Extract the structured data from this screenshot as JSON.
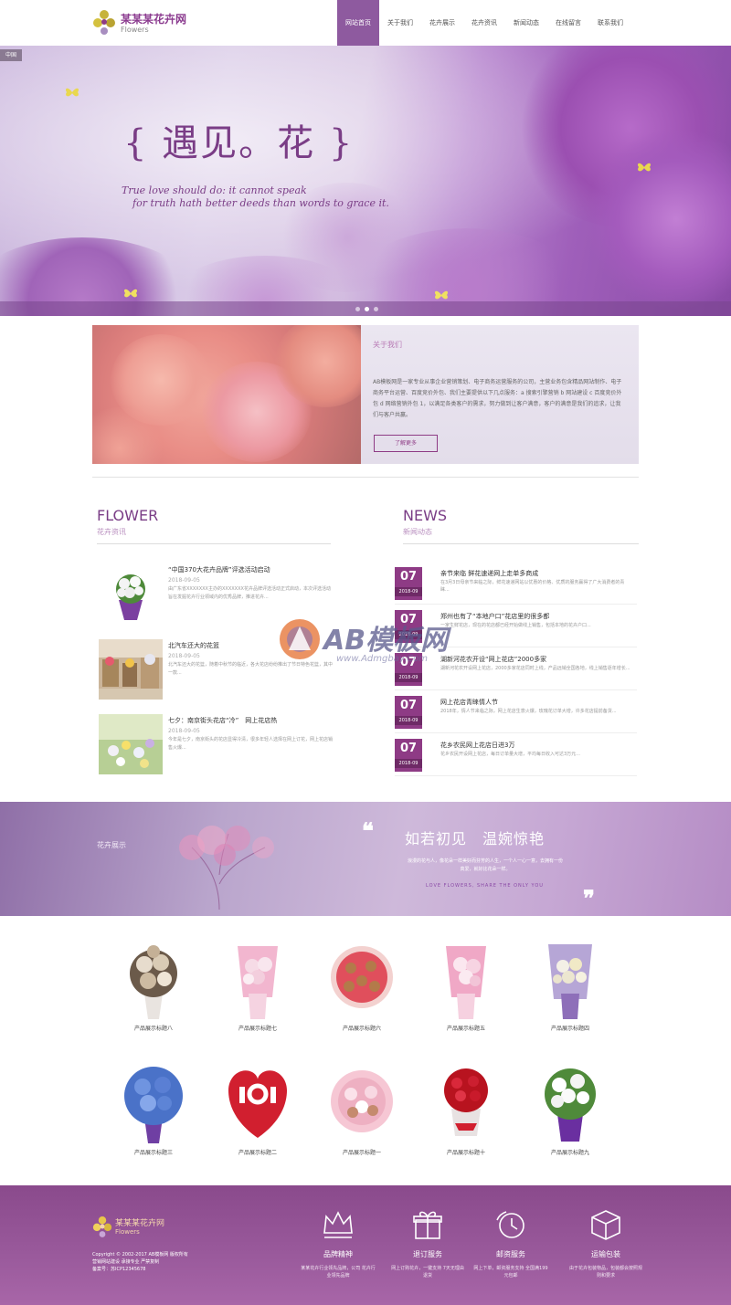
{
  "header": {
    "logo_title": "某某某花卉网",
    "logo_sub": "Flowers",
    "nav": [
      "网站首页",
      "关于我们",
      "花卉展示",
      "花卉资讯",
      "新闻动态",
      "在线留言",
      "联系我们"
    ]
  },
  "banner": {
    "tag": "中国",
    "title": "{ 遇见。花 }",
    "script_line1": "True love should do: it cannot speak",
    "script_line2": "for truth hath better deeds than words to grace it."
  },
  "about": {
    "heading": "关于我们",
    "text": "AB模板网是一家专业从事企业营销策划、电子商务运营服务的公司，主营业务包含精品网站制作、电子商务平台运营、百度竞价外包、我们主要提供以下几点服务：a 搜索引擎营销 b 网站建设 c 百度竞价外包 d 网络营销外包 1，以满足各类客户的需求，努力做到让客户满意，客户的满意是我们的追求，让我们与客户共赢。",
    "button": "了解更多"
  },
  "flower_section": {
    "title_en": "FLOWER",
    "title_cn": "花卉资讯",
    "items": [
      {
        "title": "“中国370大花卉品牌”评选活动启动",
        "date": "2018-09-05",
        "desc": "由广东省XXXXXXX主办的XXXXXXX花卉品牌评选活动正式启动，本次评选活动旨在发掘花卉行业领域内的优秀品牌，推进花卉..."
      },
      {
        "title": "北汽车还大的花篮",
        "date": "2018-09-05",
        "desc": "北汽车还大的花篮，随着中秋节的临近，各大花店纷纷推出了节日特色花篮，其中一款..."
      },
      {
        "title": "七夕：南京街头花店“冷”　网上花店热",
        "date": "2018-09-05",
        "desc": "今年是七夕，南京街头的花店显得冷清，很多年轻人选择在网上订花，网上花店销售火爆..."
      }
    ]
  },
  "news_section": {
    "title_en": "NEWS",
    "title_cn": "新闻动态",
    "items": [
      {
        "day": "07",
        "month": "2018-09",
        "title": "亲节来临 鲜花速递网上走单多商成",
        "desc": "在3月3日母亲节来临之际，鲜花速递网站以优惠的价格、优质的服务赢得了广大消费者的青睐..."
      },
      {
        "day": "07",
        "month": "2018-09",
        "title": "郑州也有了“本地户口”花店里的很多都",
        "desc": "一家生鲜花店，现在的花店都已经开始做线上销售，包括本地的花卉户口..."
      },
      {
        "day": "07",
        "month": "2018-09",
        "title": "湖新河花农开设“网上花店”2000多家",
        "desc": "湖新河花农开设网上花店，2000多家花店同时上线，产品远销全国各地，线上销售逐年增长..."
      },
      {
        "day": "07",
        "month": "2018-09",
        "title": "网上花店青睐情人节",
        "desc": "2018年，情人节来临之际，网上花店生意火爆，玫瑰花订单大增，许多花店提前备货..."
      },
      {
        "day": "07",
        "month": "2018-09",
        "title": "花乡农民网上花店日进3万",
        "desc": "花乡农民开设网上花店，每日订单量大增，平均每日收入可达3万元..."
      }
    ]
  },
  "watermark": {
    "text": "AB模板网",
    "url": "www.Admgbay.Com"
  },
  "band": {
    "label": "花卉展示",
    "quote_open": "❝",
    "quote_close": "❞",
    "title": "如若初见　温婉惊艳",
    "text": "浪漫的花与人，像花朵一样美好而芬芳的人生，一个人一心一意，去拥有一份真爱，就好比花朵一样。",
    "en": "LOVE FLOWERS, SHARE THE ONLY YOU"
  },
  "products": {
    "row1": [
      "产品展示标题八",
      "产品展示标题七",
      "产品展示标题六",
      "产品展示标题五",
      "产品展示标题四"
    ],
    "row2": [
      "产品展示标题三",
      "产品展示标题二",
      "产品展示标题一",
      "产品展示标题十",
      "产品展示标题九"
    ]
  },
  "footer": {
    "logo_title": "某某某花卉网",
    "logo_sub": "Flowers",
    "copyright": "Copyright © 2002-2017 AB模板网 版权所有",
    "copyright2": "营销网站建设 承接专业 严禁复制",
    "icp": "备案号：苏ICP12345678",
    "features": [
      {
        "icon": "crown-icon",
        "title": "品牌精神",
        "desc": "某某花卉行业领先品牌，公司 花卉行业领先品牌"
      },
      {
        "icon": "gift-icon",
        "title": "退订服务",
        "desc": "网上订购花卉，一键支持 7天无理由退货"
      },
      {
        "icon": "clock-icon",
        "title": "邮资服务",
        "desc": "网上下单，邮资服务支持 全国满199元包邮"
      },
      {
        "icon": "box-icon",
        "title": "运输包装",
        "desc": "由于花卉包装物品，包装都会按照规则和要求"
      }
    ]
  },
  "colors": {
    "brand": "#8e3b85",
    "nav_active": "#8e5a9f",
    "footer": "#8a4a8c"
  }
}
